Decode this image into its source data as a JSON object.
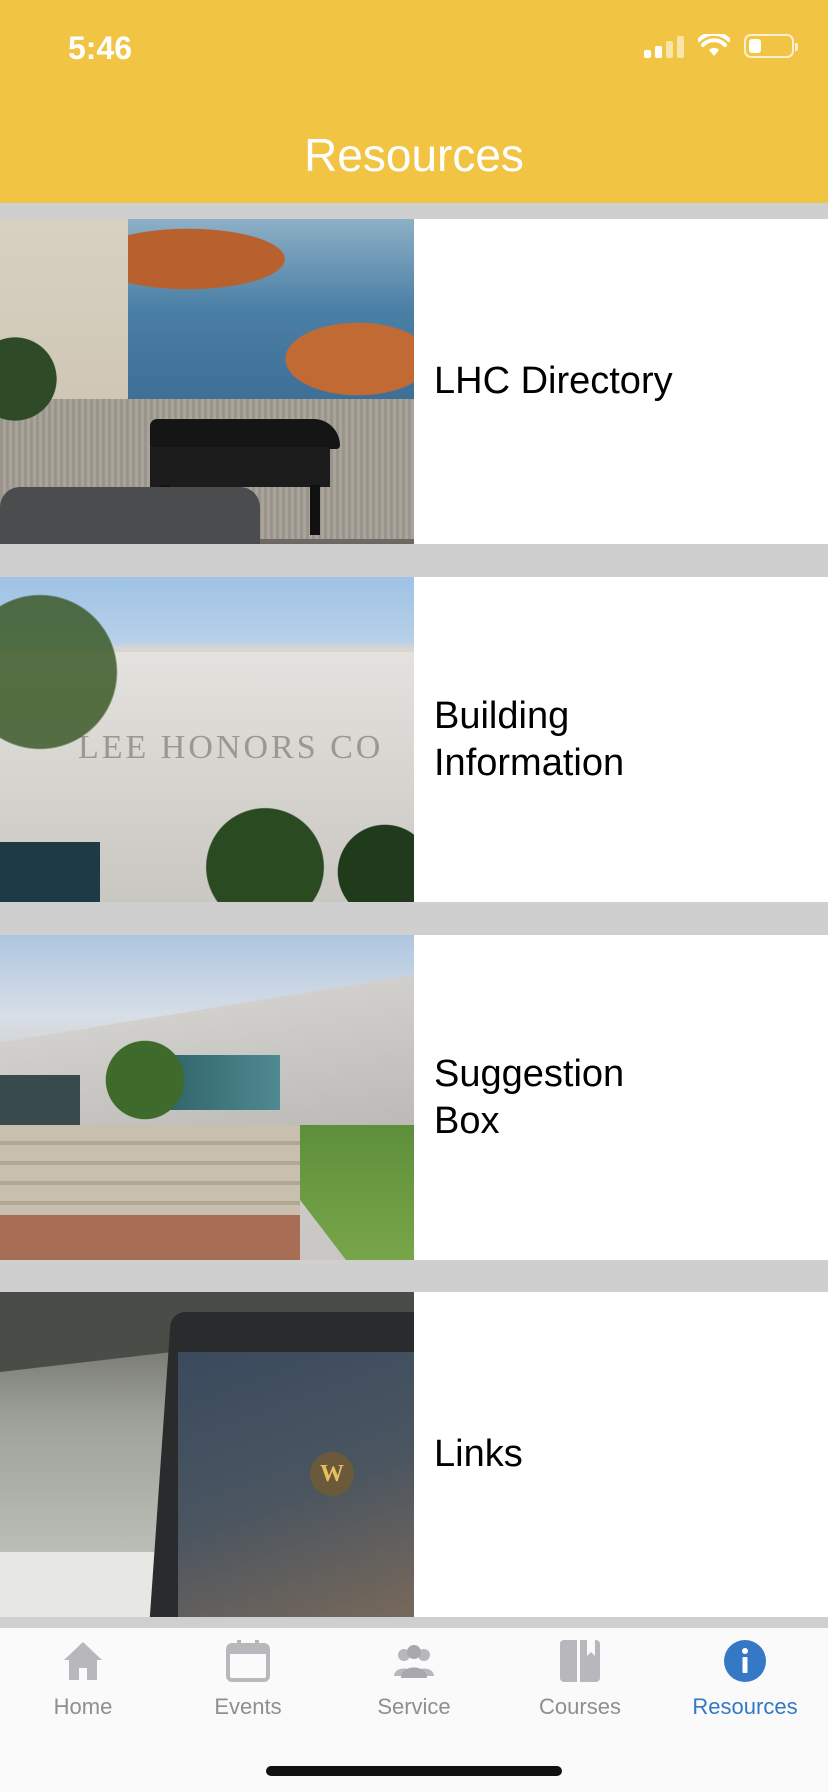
{
  "status": {
    "time": "5:46"
  },
  "header": {
    "title": "Resources"
  },
  "rows": [
    {
      "label": "LHC Directory",
      "image": "piano-lounge-photo"
    },
    {
      "label": "Building Information",
      "image": "building-sign-photo"
    },
    {
      "label": "Suggestion Box",
      "image": "building-exterior-photo"
    },
    {
      "label": "Links",
      "image": "laptop-photo"
    }
  ],
  "photo_text": {
    "building_sign": "LEE HONORS CO",
    "laptop_logo": "W"
  },
  "tabs": [
    {
      "label": "Home",
      "icon": "home-icon"
    },
    {
      "label": "Events",
      "icon": "calendar-icon"
    },
    {
      "label": "Service",
      "icon": "people-icon"
    },
    {
      "label": "Courses",
      "icon": "book-icon"
    },
    {
      "label": "Resources",
      "icon": "info-icon",
      "active": true
    }
  ],
  "colors": {
    "header": "#f2c443",
    "separator": "#cfcfcf",
    "tab_inactive": "#8e8e93",
    "tab_active": "#3478c6"
  }
}
